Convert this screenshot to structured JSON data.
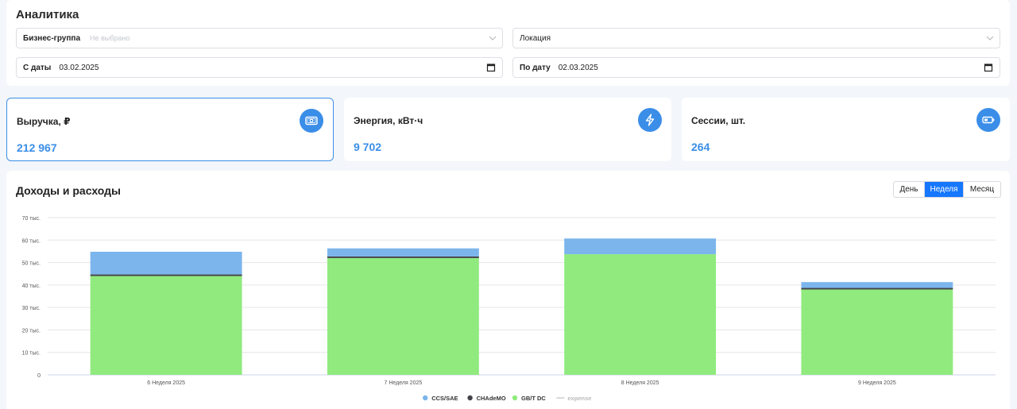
{
  "filters": {
    "title": "Аналитика",
    "business_group": {
      "label": "Бизнес-группа",
      "placeholder": "Не выбрано"
    },
    "location": {
      "label": "Локация"
    },
    "date_from": {
      "label": "С даты",
      "value": "03.02.2025"
    },
    "date_to": {
      "label": "По дату",
      "value": "02.03.2025"
    }
  },
  "kpis": [
    {
      "title": "Выручка, ₽",
      "value": "212 967",
      "icon": "money-icon",
      "active": true
    },
    {
      "title": "Энергия, кВт·ч",
      "value": "9 702",
      "icon": "lightning-icon",
      "active": false
    },
    {
      "title": "Сессии, шт.",
      "value": "264",
      "icon": "battery-icon",
      "active": false
    }
  ],
  "chart_section": {
    "title": "Доходы и расходы",
    "periods": [
      "День",
      "Неделя",
      "Месяц"
    ],
    "selected_period": "Неделя"
  },
  "chart_data": {
    "type": "bar",
    "stacked": true,
    "categories": [
      "6 Неделя 2025",
      "7 Неделя 2025",
      "8 Неделя 2025",
      "9 Неделя 2025"
    ],
    "series": [
      {
        "name": "GB/T DC",
        "color": "#90ea7e",
        "values": [
          44000,
          52000,
          53700,
          38000
        ]
      },
      {
        "name": "CHAdeMO",
        "color": "#434348",
        "values": [
          700,
          700,
          0,
          700
        ]
      },
      {
        "name": "CCS/SAE",
        "color": "#7cb5ec",
        "values": [
          10100,
          3600,
          7000,
          2600
        ]
      }
    ],
    "legend": [
      {
        "name": "CCS/SAE",
        "color": "#7cb5ec",
        "kind": "dot"
      },
      {
        "name": "CHAdeMO",
        "color": "#434348",
        "kind": "dot"
      },
      {
        "name": "GB/T DC",
        "color": "#90ea7e",
        "kind": "dot"
      },
      {
        "name": "expense",
        "color": "#cccccc",
        "kind": "line"
      }
    ],
    "yticks": [
      "0",
      "10 тыс.",
      "20 тыс.",
      "30 тыс.",
      "40 тыс.",
      "50 тыс.",
      "60 тыс.",
      "70 тыс."
    ],
    "ylim": [
      0,
      70000
    ],
    "grid": true,
    "legend_position": "bottom"
  }
}
